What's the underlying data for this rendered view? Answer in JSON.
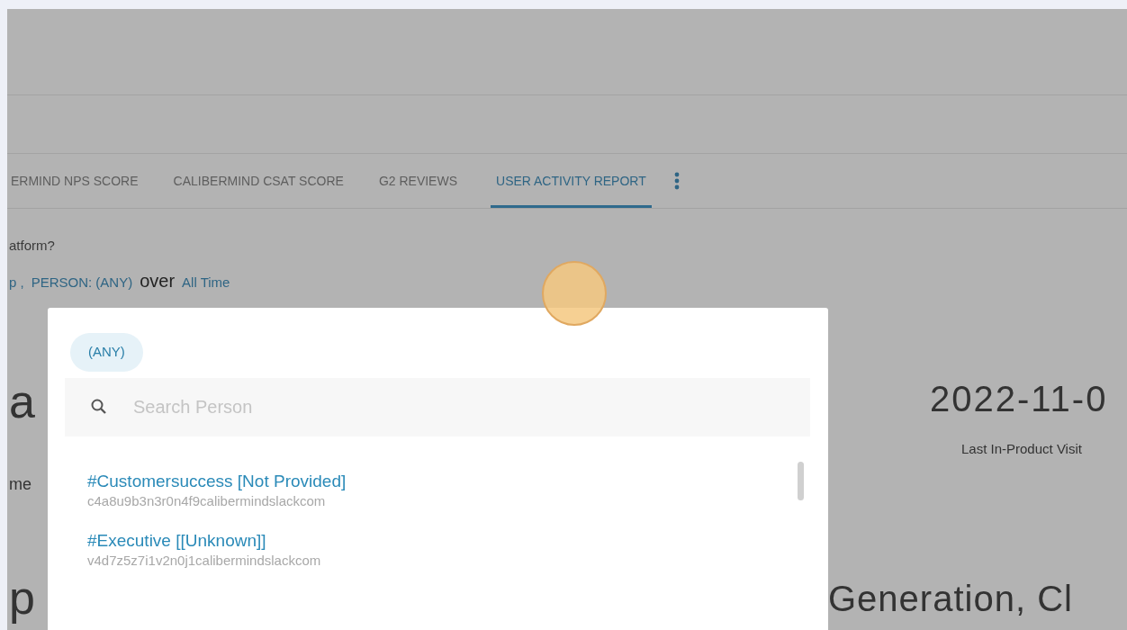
{
  "tabs": [
    {
      "label": "ERMIND NPS SCORE",
      "selected": false
    },
    {
      "label": "CALIBERMIND CSAT SCORE",
      "selected": false
    },
    {
      "label": "G2 REVIEWS",
      "selected": false
    },
    {
      "label": "USER ACTIVITY REPORT",
      "selected": true
    }
  ],
  "question": "atform?",
  "filter": {
    "segment": "p ,",
    "person": "PERSON: (ANY)",
    "connector": "over",
    "range": "All Time"
  },
  "background": {
    "heading_1": "a",
    "label_1": "me",
    "heading_2": "p",
    "stat_value": "2022-11-0",
    "stat_label": "Last In-Product Visit",
    "heading_3": "Generation, Cl"
  },
  "person_picker": {
    "chip": "(ANY)",
    "search": {
      "placeholder": "Search Person"
    },
    "options": [
      {
        "name": "#Customersuccess [Not Provided]",
        "email": "c4a8u9b3n3r0n4f9calibermindslackcom"
      },
      {
        "name": "#Executive [[Unknown]]",
        "email": "v4d7z5z7i1v2n0j1calibermindslackcom"
      }
    ]
  }
}
